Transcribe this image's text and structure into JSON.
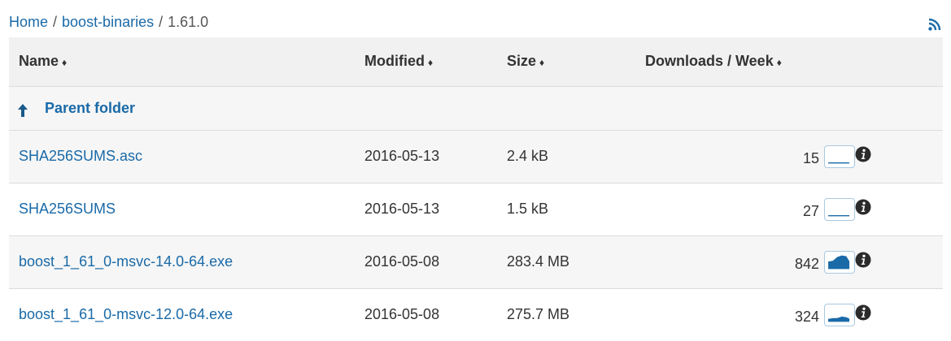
{
  "breadcrumb": {
    "items": [
      "Home",
      "boost-binaries",
      "1.61.0"
    ],
    "separator": "/"
  },
  "colors": {
    "link": "#1a6aa8",
    "spark_fill": "#1a6aa8",
    "header_bg": "#f1f1f1"
  },
  "icons": {
    "feed": "rss-icon",
    "parent": "arrow-up-icon",
    "info": "info-circle-icon"
  },
  "table": {
    "columns": [
      {
        "label": "Name",
        "sort": "♦"
      },
      {
        "label": "Modified",
        "sort": "♦"
      },
      {
        "label": "Size",
        "sort": "♦"
      },
      {
        "label": "Downloads / Week",
        "sort": "♦"
      }
    ],
    "parent_label": "Parent folder",
    "rows": [
      {
        "name": "SHA256SUMS.asc",
        "modified": "2016-05-13",
        "size": "2.4 kB",
        "downloads": "15",
        "spark_level": 0.05
      },
      {
        "name": "SHA256SUMS",
        "modified": "2016-05-13",
        "size": "1.5 kB",
        "downloads": "27",
        "spark_level": 0.05
      },
      {
        "name": "boost_1_61_0-msvc-14.0-64.exe",
        "modified": "2016-05-08",
        "size": "283.4 MB",
        "downloads": "842",
        "spark_level": 0.9
      },
      {
        "name": "boost_1_61_0-msvc-12.0-64.exe",
        "modified": "2016-05-08",
        "size": "275.7 MB",
        "downloads": "324",
        "spark_level": 0.35
      }
    ]
  }
}
